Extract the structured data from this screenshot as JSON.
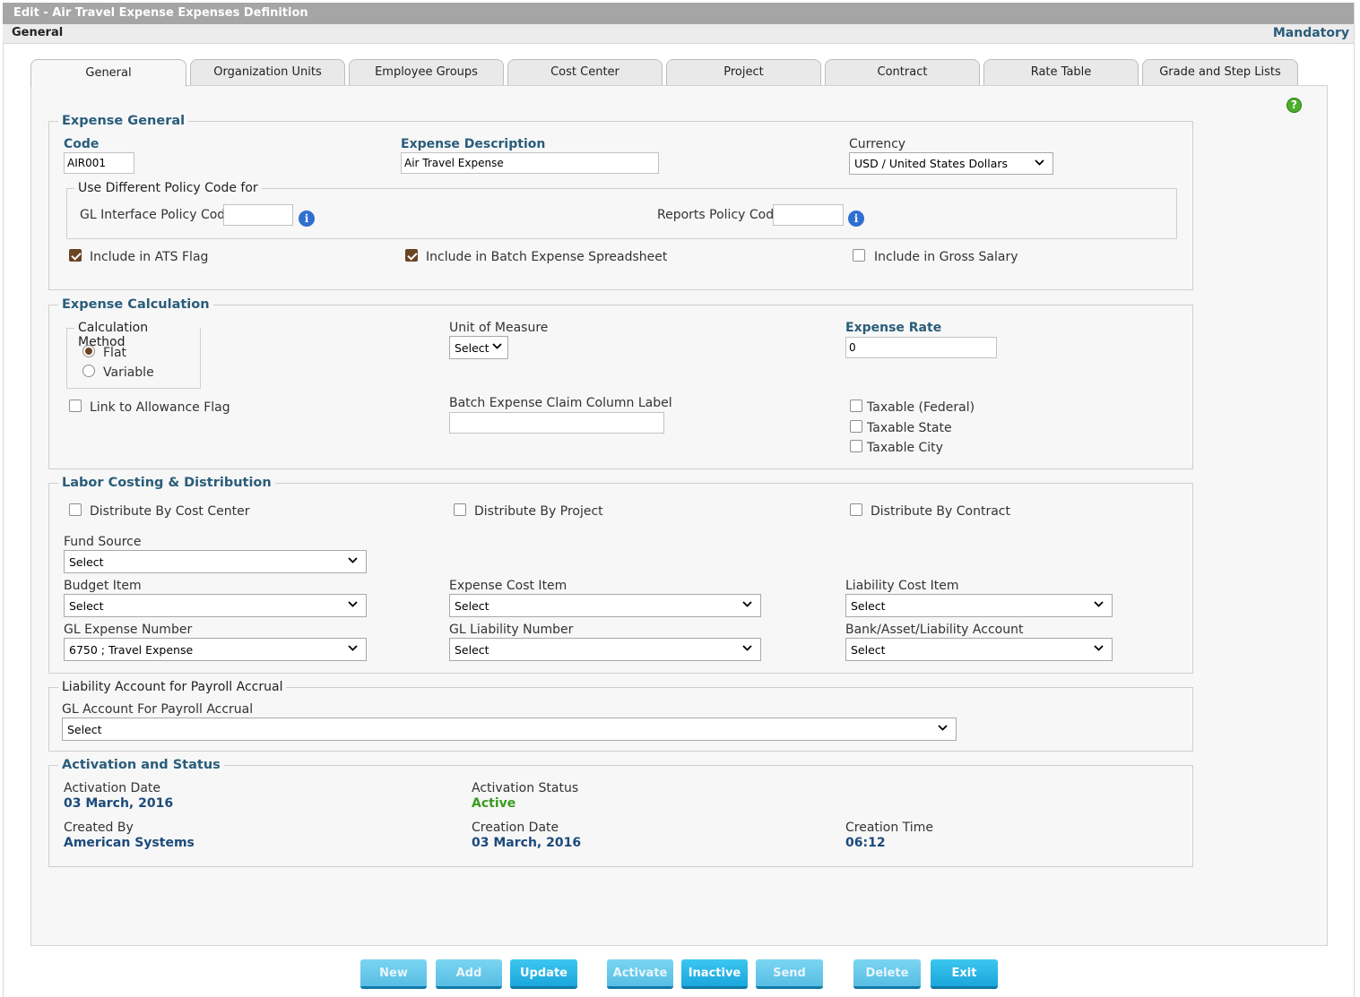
{
  "window": {
    "title": "Edit - Air Travel Expense Expenses Definition"
  },
  "subheader": {
    "section": "General",
    "mandatory": "Mandatory"
  },
  "tabs": [
    "General",
    "Organization Units",
    "Employee Groups",
    "Cost Center",
    "Project",
    "Contract",
    "Rate Table",
    "Grade and Step Lists"
  ],
  "expense_general": {
    "legend": "Expense General",
    "code_label": "Code",
    "code_value": "AIR001",
    "desc_label": "Expense Description",
    "desc_value": "Air Travel Expense",
    "currency_label": "Currency",
    "currency_value": "USD / United States Dollars",
    "policy_legend": "Use Different Policy Code for",
    "gl_policy_label": "GL Interface Policy Code",
    "gl_policy_value": "",
    "reports_policy_label": "Reports Policy Code",
    "reports_policy_value": "",
    "ats_label": "Include in ATS Flag",
    "ats_checked": true,
    "batch_label": "Include in Batch Expense Spreadsheet",
    "batch_checked": true,
    "gross_label": "Include in Gross Salary",
    "gross_checked": false
  },
  "expense_calc": {
    "legend": "Expense Calculation",
    "method_legend": "Calculation Method",
    "flat_label": "Flat",
    "variable_label": "Variable",
    "selected_method": "Flat",
    "uom_label": "Unit of Measure",
    "uom_value": "Select",
    "rate_label": "Expense Rate",
    "rate_value": "0",
    "allowance_label": "Link to Allowance Flag",
    "batch_col_label": "Batch Expense Claim Column Label",
    "batch_col_value": "",
    "tax_federal": "Taxable (Federal)",
    "tax_state": "Taxable State",
    "tax_city": "Taxable City"
  },
  "labor": {
    "legend": "Labor Costing & Distribution",
    "dist_cost_center": "Distribute By Cost Center",
    "dist_project": "Distribute By Project",
    "dist_contract": "Distribute By Contract",
    "fund_source_label": "Fund Source",
    "fund_source_value": "Select",
    "budget_item_label": "Budget Item",
    "budget_item_value": "Select",
    "expense_cost_label": "Expense Cost Item",
    "expense_cost_value": "Select",
    "liability_cost_label": "Liability Cost Item",
    "liability_cost_value": "Select",
    "gl_expense_label": "GL Expense Number",
    "gl_expense_value": "6750 ; Travel Expense",
    "gl_liability_label": "GL Liability Number",
    "gl_liability_value": "Select",
    "bank_label": "Bank/Asset/Liability Account",
    "bank_value": "Select"
  },
  "accrual": {
    "legend": "Liability Account for Payroll Accrual",
    "gl_account_label": "GL Account For Payroll Accrual",
    "gl_account_value": "Select"
  },
  "activation": {
    "legend": "Activation and Status",
    "activation_date_label": "Activation Date",
    "activation_date": "03 March, 2016",
    "status_label": "Activation Status",
    "status": "Active",
    "created_by_label": "Created By",
    "created_by": "American Systems",
    "creation_date_label": "Creation Date",
    "creation_date": "03 March, 2016",
    "creation_time_label": "Creation Time",
    "creation_time": "06:12"
  },
  "buttons": {
    "new": "New",
    "add": "Add",
    "update": "Update",
    "activate": "Activate",
    "inactive": "Inactive",
    "send": "Send",
    "delete": "Delete",
    "exit": "Exit"
  },
  "help_icon": "?",
  "info_icon": "i",
  "colors": {
    "accent": "#2a5d7a",
    "button": "#1aa6dc",
    "status_active": "#3a9b1f",
    "checkbox": "#6b4424"
  }
}
